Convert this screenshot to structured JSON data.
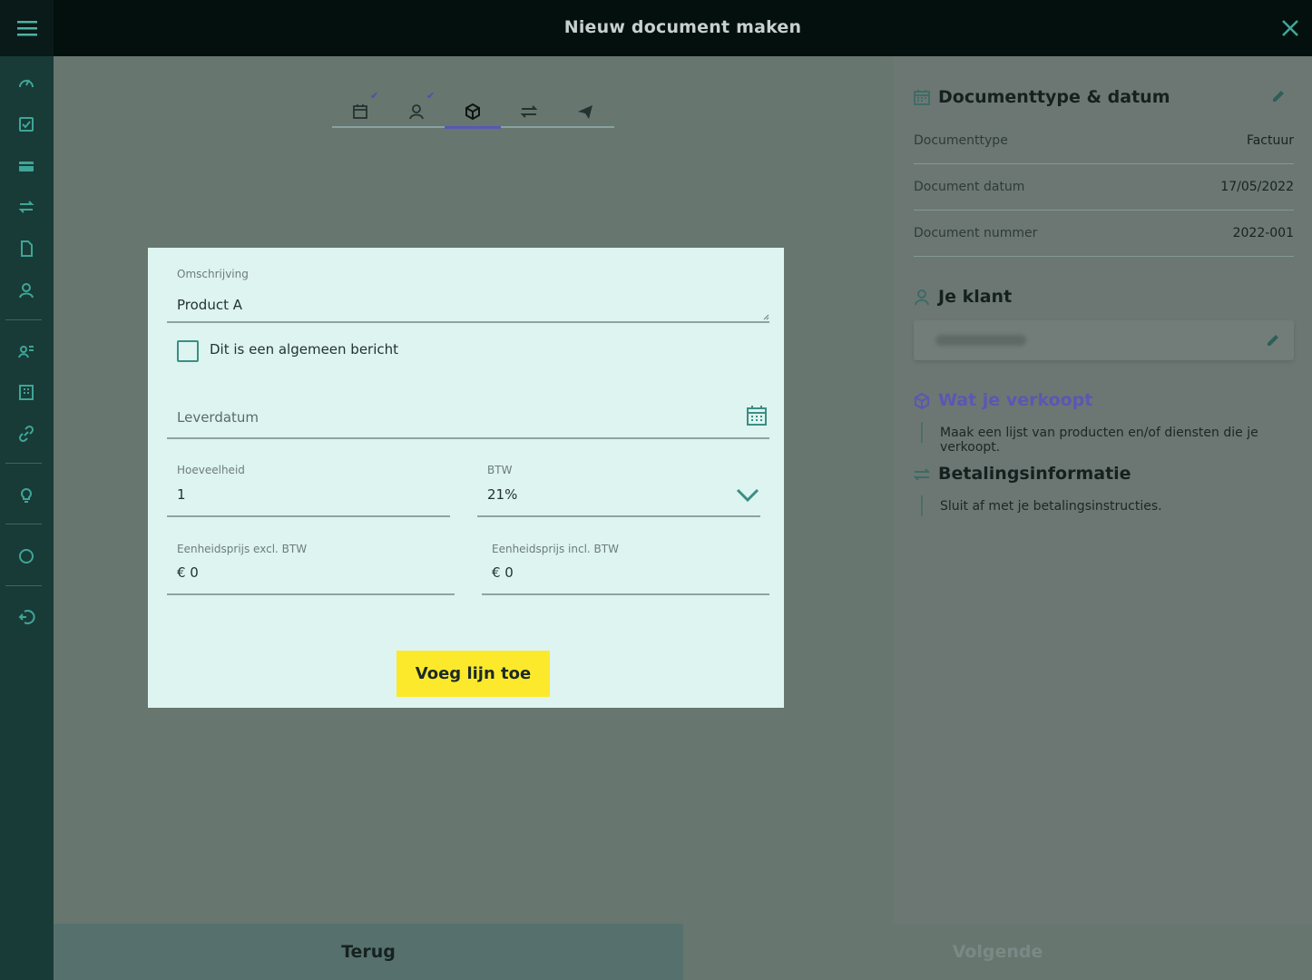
{
  "header": {
    "title": "Nieuw document maken",
    "close_icon": "close-icon",
    "menu_icon": "hamburger-menu-icon"
  },
  "sidebar": {
    "icons": [
      "speedometer-icon",
      "checkbox-icon",
      "card-icon",
      "transfer-icon",
      "document-icon",
      "contacts-icon",
      "contact-list-icon",
      "building-icon",
      "link-icon",
      "lightbulb-icon",
      "circle-icon",
      "logout-icon"
    ]
  },
  "stepper": {
    "steps": [
      {
        "icon": "calendar-icon",
        "done": true
      },
      {
        "icon": "person-icon",
        "done": true
      },
      {
        "icon": "box-icon",
        "active": true
      },
      {
        "icon": "transfer-icon"
      },
      {
        "icon": "send-icon"
      }
    ]
  },
  "form": {
    "description_label": "Omschrijving",
    "description_value": "Product A",
    "general_message_label": "Dit is een algemeen bericht",
    "delivery_date_placeholder": "Leverdatum",
    "quantity_label": "Hoeveelheid",
    "quantity_value": "1",
    "vat_label": "BTW",
    "vat_value": "21%",
    "unit_price_excl_label": "Eenheidsprijs excl. BTW",
    "unit_price_excl_value": "€ 0",
    "unit_price_incl_label": "Eenheidsprijs incl. BTW",
    "unit_price_incl_value": "€ 0",
    "add_line_button": "Voeg lijn toe"
  },
  "summary": {
    "doc_section_title": "Documenttype & datum",
    "rows": [
      {
        "label": "Documenttype",
        "value": "Factuur"
      },
      {
        "label": "Document datum",
        "value": "17/05/2022"
      },
      {
        "label": "Document nummer",
        "value": "2022-001"
      }
    ],
    "client_section_title": "Je klant",
    "sell_section_title": "Wat je verkoopt",
    "sell_section_text": "Maak een lijst van producten en/of diensten die je verkoopt.",
    "payment_section_title": "Betalingsinformatie",
    "payment_section_text": "Sluit af met je betalingsinstructies."
  },
  "footer": {
    "back_label": "Terug",
    "next_label": "Volgende"
  },
  "colors": {
    "accent_purple": "#5a57b4",
    "teal": "#3c8e84",
    "button_yellow": "#fde92c",
    "sidebar_bg": "#183b37"
  }
}
